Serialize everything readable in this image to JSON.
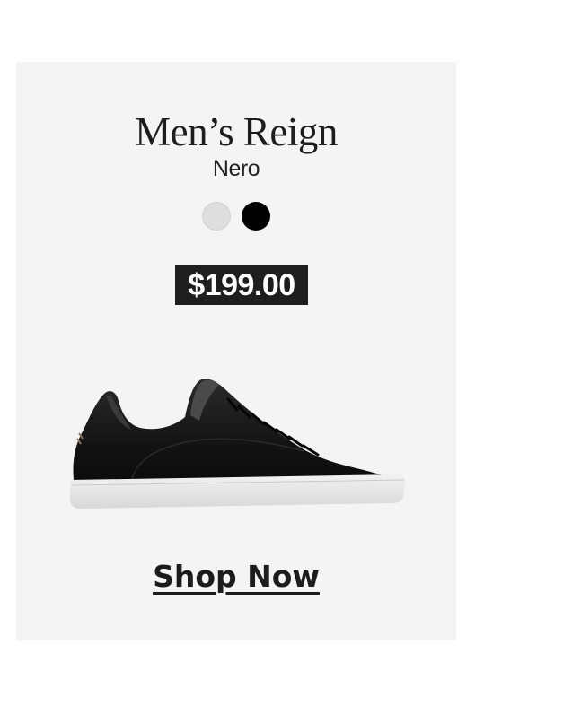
{
  "product": {
    "title": "Men’s Reign",
    "color_name": "Nero",
    "price": "$199.00",
    "swatches": [
      {
        "name": "white",
        "color": "#dedede"
      },
      {
        "name": "black",
        "color": "#000000"
      }
    ],
    "image": "black leather low-top sneaker with white sole"
  },
  "cta": {
    "label": "Shop Now"
  },
  "colors": {
    "card_background": "#f4f4f4",
    "price_badge": "#1e1e1e",
    "text": "#1d1d1d"
  }
}
